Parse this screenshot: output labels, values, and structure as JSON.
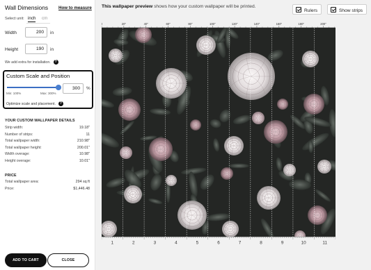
{
  "dimensions": {
    "title": "Wall Dimensions",
    "how_to_measure": "How to measure",
    "select_unit_label": "Select unit:",
    "unit_inch": "inch",
    "unit_cm": "cm",
    "width_label": "Width",
    "width_value": "200",
    "height_label": "Height",
    "height_value": "190",
    "unit_suffix": "in",
    "extra_note": "We add extra for installation."
  },
  "scale": {
    "title": "Custom Scale and Position",
    "min_label": "Min: 100%",
    "max_label": "Max: 300%",
    "value": "300",
    "value_fraction": 1.0,
    "percent_suffix": "%",
    "optimize_note": "Optimize scale and placement."
  },
  "details": {
    "heading": "YOUR CUSTOM WALLPAPER DETAILS",
    "rows": [
      {
        "label": "Strip width:",
        "value": "19.18\""
      },
      {
        "label": "Number of strips:",
        "value": "11"
      },
      {
        "label": "Total wallpaper width:",
        "value": "210.98\""
      },
      {
        "label": "Total wallpaper height:",
        "value": "200.01\""
      },
      {
        "label": "Width overage:",
        "value": "10.98\""
      },
      {
        "label": "Height overage:",
        "value": "10.01\""
      }
    ]
  },
  "price": {
    "heading": "PRICE",
    "rows": [
      {
        "label": "Total wallpaper area:",
        "value": "294 sq ft"
      },
      {
        "label": "Price:",
        "value": "$1,446.48"
      }
    ]
  },
  "buttons": {
    "add_to_cart": "ADD TO CART",
    "close": "CLOSE"
  },
  "preview": {
    "bold_text": "This wallpaper preview",
    "text": " shows how your custom wallpaper will be printed.",
    "rulers_label": "Rulers",
    "rulers_checked": true,
    "strips_label": "Show strips",
    "strips_checked": true,
    "ruler_top_labels": [
      "0",
      "20\"",
      "40\"",
      "60\"",
      "80\"",
      "100\"",
      "120\"",
      "140\"",
      "160\"",
      "180\"",
      "200\""
    ],
    "strip_numbers": [
      "1",
      "2",
      "3",
      "4",
      "5",
      "6",
      "7",
      "8",
      "9",
      "10",
      "11"
    ]
  },
  "colors": {
    "accent": "#3b6fc4",
    "button_dark": "#111111",
    "preview_bg": "#f1f1f1"
  }
}
